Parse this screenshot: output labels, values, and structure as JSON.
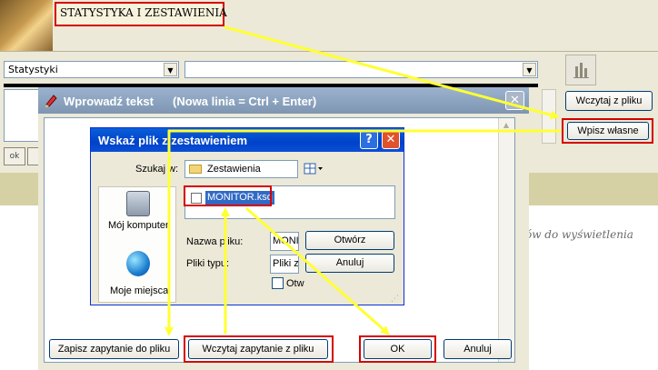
{
  "app": {
    "title": "STATYSTYKA I ZESTAWIENIA",
    "stats_combo_value": "Statystyki",
    "second_combo_value": "",
    "load_file_label": "Wczytaj z pliku",
    "enter_own_label": "Wpisz własne",
    "ok_small_label": "ok",
    "empty_hint": "ów do wyświetlenia"
  },
  "text_window": {
    "title": "Wprowadź tekst",
    "title_hint": "(Nowa linia = Ctrl + Enter)",
    "buttons": {
      "save_query": "Zapisz zapytanie do pliku",
      "load_query": "Wczytaj zapytanie z pliku",
      "ok": "OK",
      "cancel": "Anuluj"
    }
  },
  "file_dialog": {
    "title": "Wskaż plik z zestawieniem",
    "look_in_label": "Szukaj w:",
    "look_in_value": "Zestawienia",
    "places": [
      "Mój komputer",
      "Moje miejsca"
    ],
    "files": [
      "MONITOR.ksq"
    ],
    "filename_label": "Nazwa pliku:",
    "filename_value": "MONI",
    "filetype_label": "Pliki typu:",
    "filetype_value": "Pliki z",
    "readonly_label": "Otw",
    "open_button": "Otwórz",
    "cancel_button": "Anuluj"
  },
  "colors": {
    "highlight_frame": "#d40000",
    "annotation_arrow": "#ffff33",
    "dialog_titlebar": "#0a5fd8",
    "selection": "#316ac5"
  },
  "icons": [
    "logo-image",
    "chart-icon",
    "pencil-icon",
    "close-icon",
    "help-icon",
    "folder-icon",
    "views-icon",
    "computer-icon",
    "network-places-icon",
    "file-icon",
    "resize-grip-icon",
    "dropdown-arrow-icon",
    "scroll-up-icon",
    "scroll-down-icon"
  ]
}
